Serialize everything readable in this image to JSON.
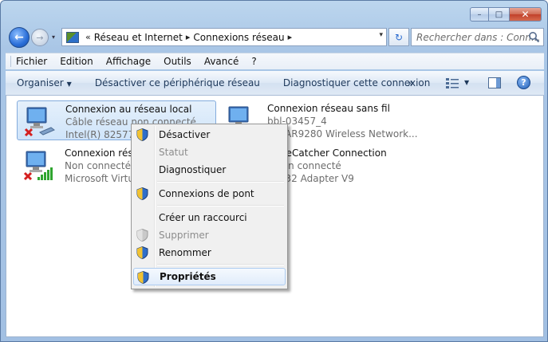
{
  "window": {
    "caption": {
      "min": "–",
      "max": "□",
      "close": "✕"
    }
  },
  "nav": {
    "back_glyph": "←",
    "fwd_glyph": "→",
    "history_glyph": "▾",
    "address": {
      "prefix": "«",
      "crumbs": [
        "Réseau et Internet",
        "Connexions réseau"
      ],
      "separator": "▸"
    },
    "refresh_glyph": "↻",
    "search_placeholder": "Rechercher dans : Conn..."
  },
  "menubar": [
    "Fichier",
    "Edition",
    "Affichage",
    "Outils",
    "Avancé",
    "?"
  ],
  "commandbar": {
    "organiser": "Organiser",
    "disable": "Désactiver ce périphérique réseau",
    "diagnose": "Diagnostiquer cette connexion",
    "more": "»",
    "help": "?"
  },
  "connections": [
    {
      "name": "Connexion au réseau local",
      "status": "Câble réseau non connecté",
      "device": "Intel(R) 82577LC",
      "kind": "wired"
    },
    {
      "name": "Connexion réseau sans fil",
      "status": "bbl-03457_4",
      "device": "ros AR9280 Wireless Network...",
      "kind": "wireless"
    },
    {
      "name": "Connexion résea",
      "status": "Non connecté",
      "device": "Microsoft Virtua",
      "kind": "virtual"
    },
    {
      "name": "2m-eCatcher Connection",
      "status": "e non connecté",
      "device": "Win32 Adapter V9",
      "kind": "tap"
    }
  ],
  "context_menu": [
    {
      "label": "Désactiver",
      "shield": true
    },
    {
      "label": "Statut",
      "disabled": true
    },
    {
      "label": "Diagnostiquer"
    },
    {
      "separator": true
    },
    {
      "label": "Connexions de pont",
      "shield": true
    },
    {
      "separator": true
    },
    {
      "label": "Créer un raccourci"
    },
    {
      "label": "Supprimer",
      "shield": true,
      "disabled": true
    },
    {
      "label": "Renommer",
      "shield": true
    },
    {
      "separator": true
    },
    {
      "label": "Propriétés",
      "shield": true,
      "bold": true,
      "hover": true
    }
  ],
  "colors": {
    "accent": "#1e395b",
    "status_error": "#d41f1f",
    "signal": "#2fa52f"
  }
}
